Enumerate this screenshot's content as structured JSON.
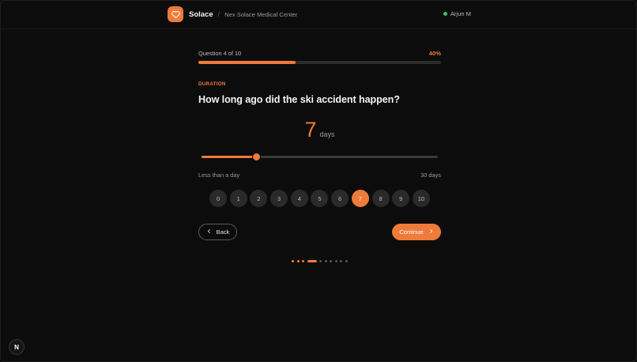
{
  "header": {
    "brand": "Solace",
    "separator": "/",
    "organization": "Nex Solace Medical Center",
    "user_name": "Arjun M"
  },
  "progress": {
    "label": "Question 4 of 10",
    "percent_label": "40%",
    "fraction": 0.4
  },
  "question": {
    "section": "DURATION",
    "text": "How long ago did the ski accident happen?"
  },
  "answer": {
    "value": "7",
    "unit": "days",
    "min": 0,
    "max": 30,
    "current": 7,
    "min_label": "Less than a day",
    "max_label": "30 days"
  },
  "quick_picks": [
    "0",
    "1",
    "2",
    "3",
    "4",
    "5",
    "6",
    "7",
    "8",
    "9",
    "10"
  ],
  "quick_pick_selected": "7",
  "buttons": {
    "back": "Back",
    "continue": "Continue"
  },
  "steps": {
    "total": 10,
    "current": 4
  },
  "badge": {
    "letter": "N"
  },
  "colors": {
    "accent": "#ee7b3a",
    "online": "#3fbf6a",
    "background": "#0c0c0c"
  },
  "icons": {
    "logo": "heart-icon",
    "back": "chevron-left-icon",
    "continue": "chevron-right-icon"
  }
}
